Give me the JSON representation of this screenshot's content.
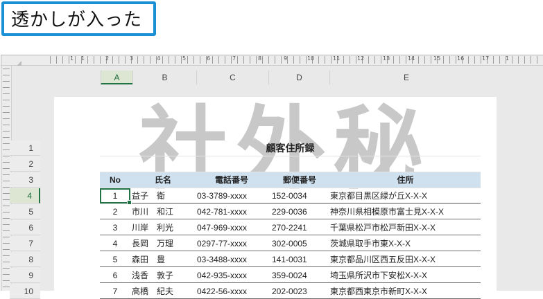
{
  "caption": "透かしが入った",
  "colors": {
    "accent": "#1a8fd6",
    "excel_green": "#217346",
    "header_fill": "#cfe0ef",
    "watermark": "#c8c8c8"
  },
  "ruler": {
    "numbers": [
      "1",
      "1",
      "2",
      "3",
      "4",
      "5",
      "6",
      "7",
      "8",
      "9",
      "10",
      "11",
      "12",
      "13",
      "14",
      "15",
      "16",
      "17",
      "1"
    ]
  },
  "columns": [
    "A",
    "B",
    "C",
    "D",
    "E"
  ],
  "active_column": "A",
  "rows": [
    "1",
    "2",
    "3",
    "4",
    "5",
    "6",
    "7",
    "8",
    "9",
    "10"
  ],
  "active_row": "4",
  "watermark_text": "社外秘",
  "sheet": {
    "title": "顧客住所録",
    "headers": {
      "no": "No",
      "name": "氏名",
      "phone": "電話番号",
      "zip": "郵便番号",
      "address": "住所"
    },
    "records": [
      {
        "no": "1",
        "name": "益子　衛",
        "phone": "03-3789-xxxx",
        "zip": "152-0034",
        "address": "東京都目黒区緑が丘X-X-X"
      },
      {
        "no": "2",
        "name": "市川　和江",
        "phone": "042-781-xxxx",
        "zip": "229-0036",
        "address": "神奈川県相模原市富士見X-X-X"
      },
      {
        "no": "3",
        "name": "川岸　利光",
        "phone": "047-969-xxxx",
        "zip": "270-2241",
        "address": "千葉県松戸市松戸新田X-X-X"
      },
      {
        "no": "4",
        "name": "長岡　万理",
        "phone": "0297-77-xxxx",
        "zip": "302-0005",
        "address": "茨城県取手市東X-X-X"
      },
      {
        "no": "5",
        "name": "森田　豊",
        "phone": "03-3488-xxxx",
        "zip": "141-0031",
        "address": "東京都品川区西五反田X-X-X"
      },
      {
        "no": "6",
        "name": "浅香　敦子",
        "phone": "042-935-xxxx",
        "zip": "359-0024",
        "address": "埼玉県所沢市下安松X-X-X"
      },
      {
        "no": "7",
        "name": "高橋　紀夫",
        "phone": "0422-56-xxxx",
        "zip": "202-0023",
        "address": "東京都西東京市新町X-X-X"
      }
    ]
  }
}
